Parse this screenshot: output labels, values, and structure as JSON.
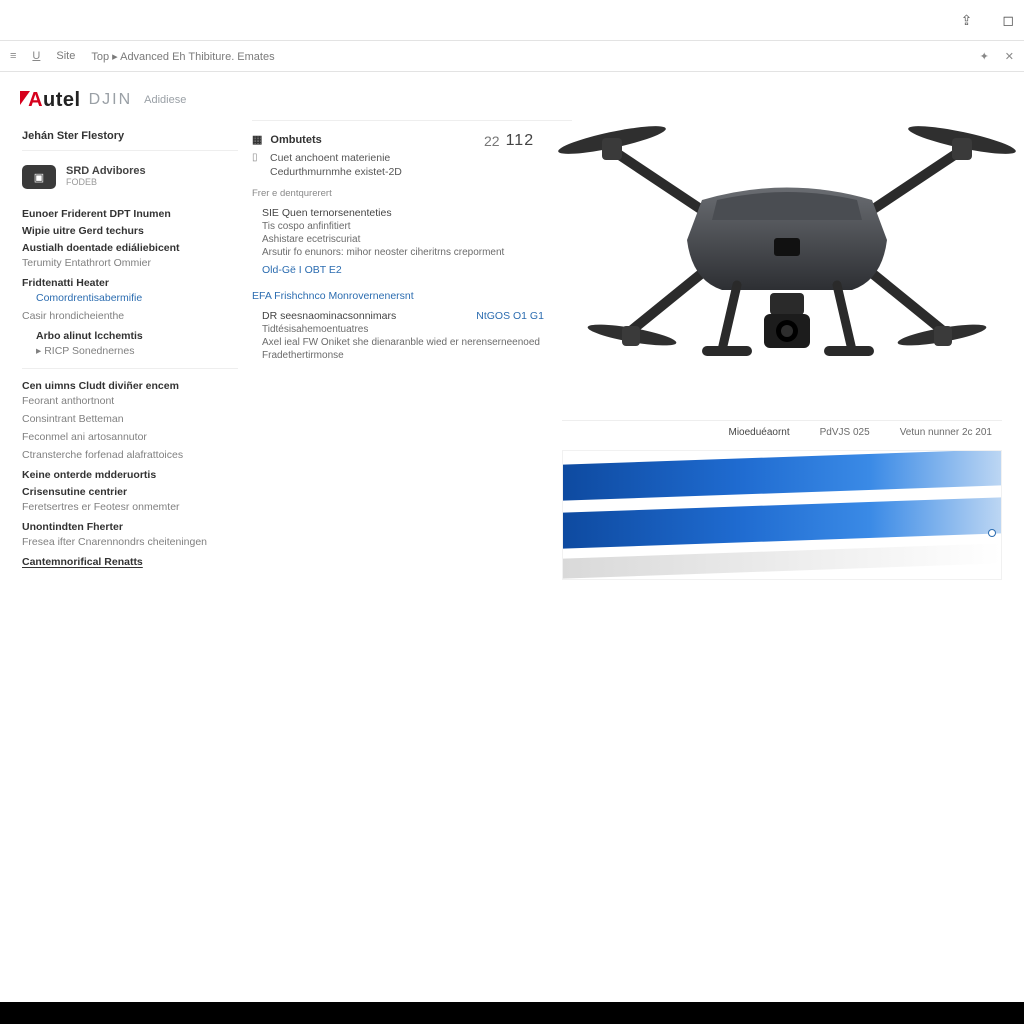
{
  "chrome": {
    "share_icon": "share-icon",
    "bookmark_icon": "bookmark-icon"
  },
  "toolbar": {
    "menu_icon": "menu-icon",
    "format_icon": "format-icon",
    "label_site": "Site",
    "label_breadcrumb": "Top  ▸  Advanced Eh Thibiture.  Emates",
    "sparkle_icon": "sparkle-icon",
    "close_icon": "close-icon"
  },
  "brand": {
    "logo_text_first": "A",
    "logo_text_rest": "utel",
    "sub": "DJIN",
    "tag": "Adidiese"
  },
  "sidebar": {
    "heading": "Jehán Ster Flestory",
    "hero": {
      "icon": "camera-icon",
      "title": "SRD Advibores",
      "subtitle": "FODEB"
    },
    "groups": [
      {
        "title": "Eunoer Friderent DPT Inumen",
        "items": []
      },
      {
        "title": "Wipie uitre Gerd techurs",
        "items": []
      },
      {
        "title": "Austialh doentade ediáliebicent",
        "items": [
          "Terumity Entathrort Ommier"
        ]
      },
      {
        "title": "Fridtenatti Heater",
        "items": [
          "Comordrentisabermifie",
          "Casir hrondicheienthe"
        ],
        "links": true
      },
      {
        "title": "Arbo alinut lcchemtis",
        "items": [
          "RICP Sonednernes"
        ],
        "indent": true,
        "icon": "tag-icon"
      },
      {
        "title": "Cen uimns Cludt diviñer encem",
        "items": [
          "Feorant anthortnont",
          "Consintrant Betteman",
          "Feconmel ani artosannutor",
          "Ctransterche forfenad alafrattoices"
        ]
      },
      {
        "title": "Keine onterde mdderuortis",
        "items": []
      },
      {
        "title": "Crisensutine centrier",
        "items": [
          "Feretsertres er Feotesr onmemter"
        ]
      },
      {
        "title": "Unontindten Fherter",
        "items": [
          "Fresea ifter Cnarennondrs cheiteningen"
        ]
      },
      {
        "title": "Cantemnorifical Renatts",
        "items": [],
        "underline": true
      }
    ]
  },
  "article": {
    "header_icon": "grid-icon",
    "header": "Ombutets",
    "lead_lines": [
      "Cuet anchoent materienie",
      "Cedurthmurnmhe existet-2D"
    ],
    "stat_prefix": "22",
    "stat_value": "112",
    "kicker": "Frer e dentqurerert",
    "section1": {
      "title": "SIE Quen ternorsenenteties",
      "lines": [
        "Tis cospo anfinfitiert",
        "Ashistare ecetriscuriat",
        "Arsutir fo enunors: mihor neoster ciheritrns creporment"
      ],
      "link": "Old-Gë I OBT E2"
    },
    "group_title": "EFA Frishchnco Monrovernenersnt",
    "section2": {
      "title": "DR seesnaominacsonnimars",
      "model": "NtGOS O1 G1",
      "lines": [
        "Tidtésisahemoentuatres",
        "Axel ieal FW Oniket she dienaranble wied er nerenserneenoed",
        "Fradethertirmonse"
      ]
    }
  },
  "banner": {
    "tab1": "Mioeduéaornt",
    "tab2": "PdVJS 025",
    "tab3": "Vetun nunner 2c 201"
  }
}
